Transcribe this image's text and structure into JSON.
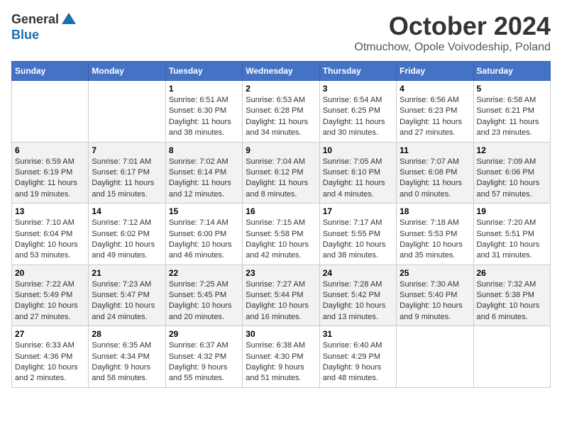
{
  "logo": {
    "general": "General",
    "blue": "Blue"
  },
  "title": "October 2024",
  "subtitle": "Otmuchow, Opole Voivodeship, Poland",
  "days_of_week": [
    "Sunday",
    "Monday",
    "Tuesday",
    "Wednesday",
    "Thursday",
    "Friday",
    "Saturday"
  ],
  "weeks": [
    [
      {
        "day": "",
        "info": ""
      },
      {
        "day": "",
        "info": ""
      },
      {
        "day": "1",
        "info": "Sunrise: 6:51 AM\nSunset: 6:30 PM\nDaylight: 11 hours and 38 minutes."
      },
      {
        "day": "2",
        "info": "Sunrise: 6:53 AM\nSunset: 6:28 PM\nDaylight: 11 hours and 34 minutes."
      },
      {
        "day": "3",
        "info": "Sunrise: 6:54 AM\nSunset: 6:25 PM\nDaylight: 11 hours and 30 minutes."
      },
      {
        "day": "4",
        "info": "Sunrise: 6:56 AM\nSunset: 6:23 PM\nDaylight: 11 hours and 27 minutes."
      },
      {
        "day": "5",
        "info": "Sunrise: 6:58 AM\nSunset: 6:21 PM\nDaylight: 11 hours and 23 minutes."
      }
    ],
    [
      {
        "day": "6",
        "info": "Sunrise: 6:59 AM\nSunset: 6:19 PM\nDaylight: 11 hours and 19 minutes."
      },
      {
        "day": "7",
        "info": "Sunrise: 7:01 AM\nSunset: 6:17 PM\nDaylight: 11 hours and 15 minutes."
      },
      {
        "day": "8",
        "info": "Sunrise: 7:02 AM\nSunset: 6:14 PM\nDaylight: 11 hours and 12 minutes."
      },
      {
        "day": "9",
        "info": "Sunrise: 7:04 AM\nSunset: 6:12 PM\nDaylight: 11 hours and 8 minutes."
      },
      {
        "day": "10",
        "info": "Sunrise: 7:05 AM\nSunset: 6:10 PM\nDaylight: 11 hours and 4 minutes."
      },
      {
        "day": "11",
        "info": "Sunrise: 7:07 AM\nSunset: 6:08 PM\nDaylight: 11 hours and 0 minutes."
      },
      {
        "day": "12",
        "info": "Sunrise: 7:09 AM\nSunset: 6:06 PM\nDaylight: 10 hours and 57 minutes."
      }
    ],
    [
      {
        "day": "13",
        "info": "Sunrise: 7:10 AM\nSunset: 6:04 PM\nDaylight: 10 hours and 53 minutes."
      },
      {
        "day": "14",
        "info": "Sunrise: 7:12 AM\nSunset: 6:02 PM\nDaylight: 10 hours and 49 minutes."
      },
      {
        "day": "15",
        "info": "Sunrise: 7:14 AM\nSunset: 6:00 PM\nDaylight: 10 hours and 46 minutes."
      },
      {
        "day": "16",
        "info": "Sunrise: 7:15 AM\nSunset: 5:58 PM\nDaylight: 10 hours and 42 minutes."
      },
      {
        "day": "17",
        "info": "Sunrise: 7:17 AM\nSunset: 5:55 PM\nDaylight: 10 hours and 38 minutes."
      },
      {
        "day": "18",
        "info": "Sunrise: 7:18 AM\nSunset: 5:53 PM\nDaylight: 10 hours and 35 minutes."
      },
      {
        "day": "19",
        "info": "Sunrise: 7:20 AM\nSunset: 5:51 PM\nDaylight: 10 hours and 31 minutes."
      }
    ],
    [
      {
        "day": "20",
        "info": "Sunrise: 7:22 AM\nSunset: 5:49 PM\nDaylight: 10 hours and 27 minutes."
      },
      {
        "day": "21",
        "info": "Sunrise: 7:23 AM\nSunset: 5:47 PM\nDaylight: 10 hours and 24 minutes."
      },
      {
        "day": "22",
        "info": "Sunrise: 7:25 AM\nSunset: 5:45 PM\nDaylight: 10 hours and 20 minutes."
      },
      {
        "day": "23",
        "info": "Sunrise: 7:27 AM\nSunset: 5:44 PM\nDaylight: 10 hours and 16 minutes."
      },
      {
        "day": "24",
        "info": "Sunrise: 7:28 AM\nSunset: 5:42 PM\nDaylight: 10 hours and 13 minutes."
      },
      {
        "day": "25",
        "info": "Sunrise: 7:30 AM\nSunset: 5:40 PM\nDaylight: 10 hours and 9 minutes."
      },
      {
        "day": "26",
        "info": "Sunrise: 7:32 AM\nSunset: 5:38 PM\nDaylight: 10 hours and 6 minutes."
      }
    ],
    [
      {
        "day": "27",
        "info": "Sunrise: 6:33 AM\nSunset: 4:36 PM\nDaylight: 10 hours and 2 minutes."
      },
      {
        "day": "28",
        "info": "Sunrise: 6:35 AM\nSunset: 4:34 PM\nDaylight: 9 hours and 58 minutes."
      },
      {
        "day": "29",
        "info": "Sunrise: 6:37 AM\nSunset: 4:32 PM\nDaylight: 9 hours and 55 minutes."
      },
      {
        "day": "30",
        "info": "Sunrise: 6:38 AM\nSunset: 4:30 PM\nDaylight: 9 hours and 51 minutes."
      },
      {
        "day": "31",
        "info": "Sunrise: 6:40 AM\nSunset: 4:29 PM\nDaylight: 9 hours and 48 minutes."
      },
      {
        "day": "",
        "info": ""
      },
      {
        "day": "",
        "info": ""
      }
    ]
  ]
}
